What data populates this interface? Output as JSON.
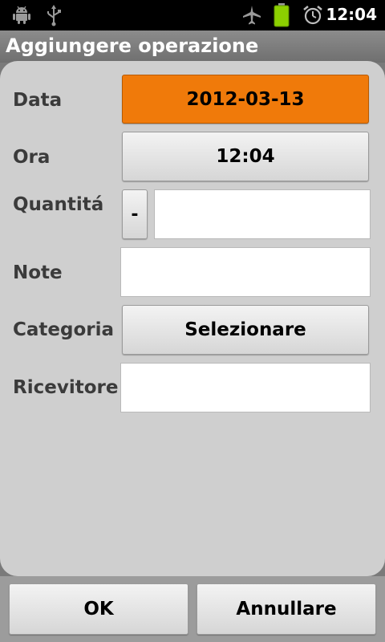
{
  "status_bar": {
    "time": "12:04",
    "icons": [
      "android-debug-icon",
      "usb-icon",
      "airplane-icon",
      "battery-icon",
      "alarm-icon"
    ],
    "battery_color": "#8cd000"
  },
  "dialog": {
    "title": "Aggiungere operazione",
    "rows": {
      "data": {
        "label": "Data",
        "value": "2012-03-13"
      },
      "ora": {
        "label": "Ora",
        "value": "12:04"
      },
      "quantita": {
        "label": "Quantitá",
        "sign_button": "-",
        "value": ""
      },
      "note": {
        "label": "Note",
        "value": ""
      },
      "categoria": {
        "label": "Categoria",
        "button": "Selezionare"
      },
      "ricevitore": {
        "label": "Ricevitore",
        "value": ""
      }
    }
  },
  "actions": {
    "ok": "OK",
    "cancel": "Annullare"
  },
  "colors": {
    "accent_orange": "#f07a0a",
    "panel_bg": "#cfcfcf"
  }
}
